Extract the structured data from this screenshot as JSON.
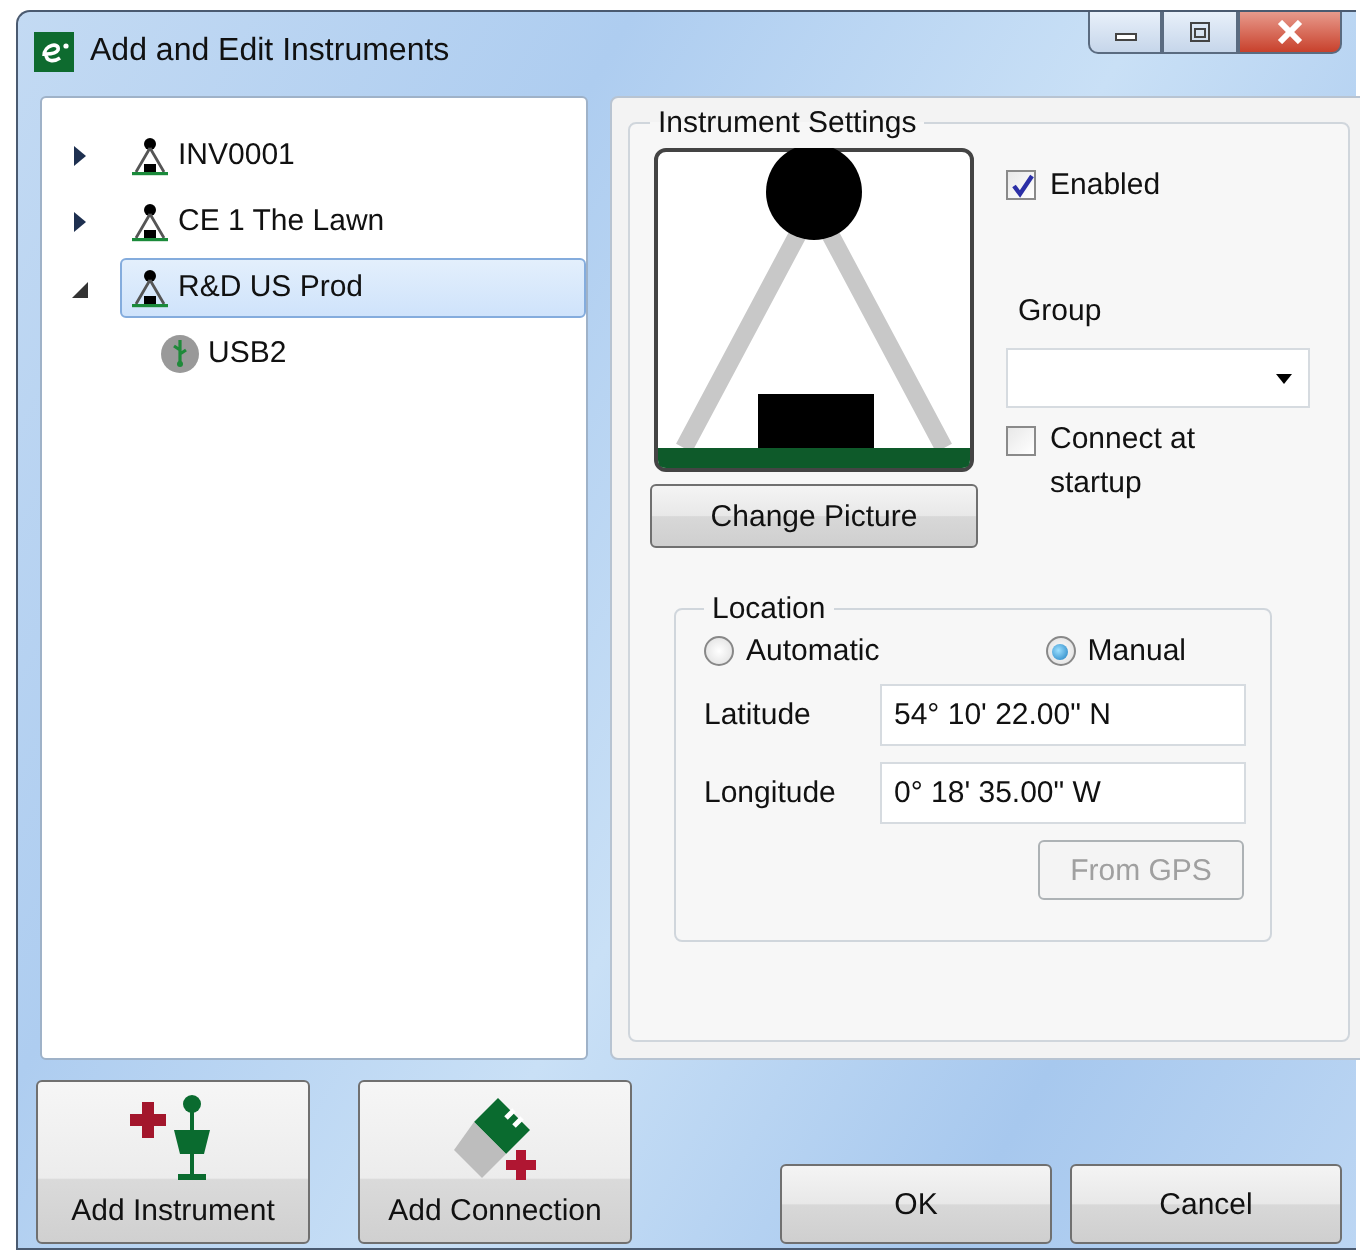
{
  "window": {
    "title": "Add and Edit Instruments"
  },
  "tree": [
    {
      "label": "INV0001",
      "kind": "instrument",
      "expanded": false,
      "selected": false
    },
    {
      "label": "CE 1 The Lawn",
      "kind": "instrument",
      "expanded": false,
      "selected": false
    },
    {
      "label": "R&D US Prod",
      "kind": "instrument",
      "expanded": true,
      "selected": true,
      "children": [
        {
          "label": "USB2",
          "kind": "connection",
          "selected": false
        }
      ]
    }
  ],
  "settings": {
    "title": "Instrument Settings",
    "change_picture": "Change Picture",
    "enabled": {
      "label": "Enabled",
      "checked": true
    },
    "group": {
      "label": "Group"
    },
    "connect": {
      "label": "Connect at startup",
      "checked": false
    },
    "location": {
      "title": "Location",
      "modes": [
        {
          "label": "Automatic",
          "selected": false
        },
        {
          "label": "Manual",
          "selected": true
        }
      ],
      "fields": [
        {
          "label": "Latitude",
          "value": "54° 10' 22.00\" N"
        },
        {
          "label": "Longitude",
          "value": "0° 18' 35.00\" W"
        }
      ],
      "gps_button": {
        "label": "From GPS",
        "disabled": true
      }
    }
  },
  "buttons": {
    "add_instrument": "Add Instrument",
    "add_connection": "Add Connection",
    "ok": "OK",
    "cancel": "Cancel"
  }
}
